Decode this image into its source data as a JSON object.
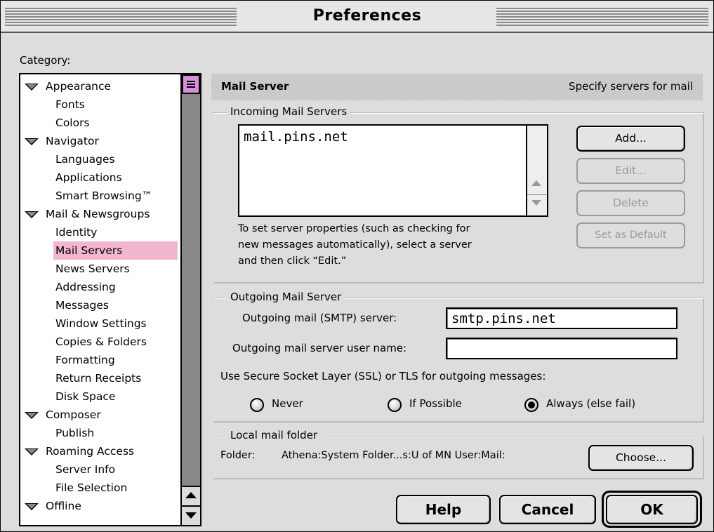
{
  "window": {
    "title": "Preferences"
  },
  "category": {
    "label": "Category:",
    "items": [
      {
        "label": "Appearance",
        "type": "parent"
      },
      {
        "label": "Fonts",
        "type": "child"
      },
      {
        "label": "Colors",
        "type": "child"
      },
      {
        "label": "Navigator",
        "type": "parent"
      },
      {
        "label": "Languages",
        "type": "child"
      },
      {
        "label": "Applications",
        "type": "child"
      },
      {
        "label": "Smart Browsing™",
        "type": "child"
      },
      {
        "label": "Mail & Newsgroups",
        "type": "parent"
      },
      {
        "label": "Identity",
        "type": "child"
      },
      {
        "label": "Mail Servers",
        "type": "child",
        "selected": true
      },
      {
        "label": "News Servers",
        "type": "child"
      },
      {
        "label": "Addressing",
        "type": "child"
      },
      {
        "label": "Messages",
        "type": "child"
      },
      {
        "label": "Window Settings",
        "type": "child"
      },
      {
        "label": "Copies & Folders",
        "type": "child"
      },
      {
        "label": "Formatting",
        "type": "child"
      },
      {
        "label": "Return Receipts",
        "type": "child"
      },
      {
        "label": "Disk Space",
        "type": "child"
      },
      {
        "label": "Composer",
        "type": "parent"
      },
      {
        "label": "Publish",
        "type": "child"
      },
      {
        "label": "Roaming Access",
        "type": "parent"
      },
      {
        "label": "Server Info",
        "type": "child"
      },
      {
        "label": "File Selection",
        "type": "child"
      },
      {
        "label": "Offline",
        "type": "parent"
      }
    ]
  },
  "panel": {
    "title": "Mail Server",
    "subtitle": "Specify servers for mail"
  },
  "incoming": {
    "legend": "Incoming Mail Servers",
    "servers": [
      "mail.pins.net"
    ],
    "help_line1": "To set server properties (such as checking for",
    "help_line2": "new messages automatically), select a server",
    "help_line3": "and then click “Edit.”",
    "add_label": "Add...",
    "edit_label": "Edit...",
    "delete_label": "Delete",
    "default_label": "Set as Default"
  },
  "outgoing": {
    "legend": "Outgoing Mail Server",
    "smtp_label": "Outgoing mail (SMTP) server:",
    "smtp_value": "smtp.pins.net",
    "user_label": "Outgoing mail server user name:",
    "user_value": "",
    "ssl_label": "Use Secure Socket Layer (SSL) or TLS for outgoing messages:",
    "options": [
      "Never",
      "If Possible",
      "Always (else fail)"
    ],
    "selected_option": "Always (else fail)"
  },
  "local": {
    "legend": "Local mail folder",
    "folder_label": "Folder:",
    "folder_path": "Athena:System Folder...s:U of MN User:Mail:",
    "choose_label": "Choose..."
  },
  "footer": {
    "help_label": "Help",
    "cancel_label": "Cancel",
    "ok_label": "OK"
  },
  "colors": {
    "selection": "#f2b6d0",
    "scroll_thumb": "#d78fd7"
  }
}
